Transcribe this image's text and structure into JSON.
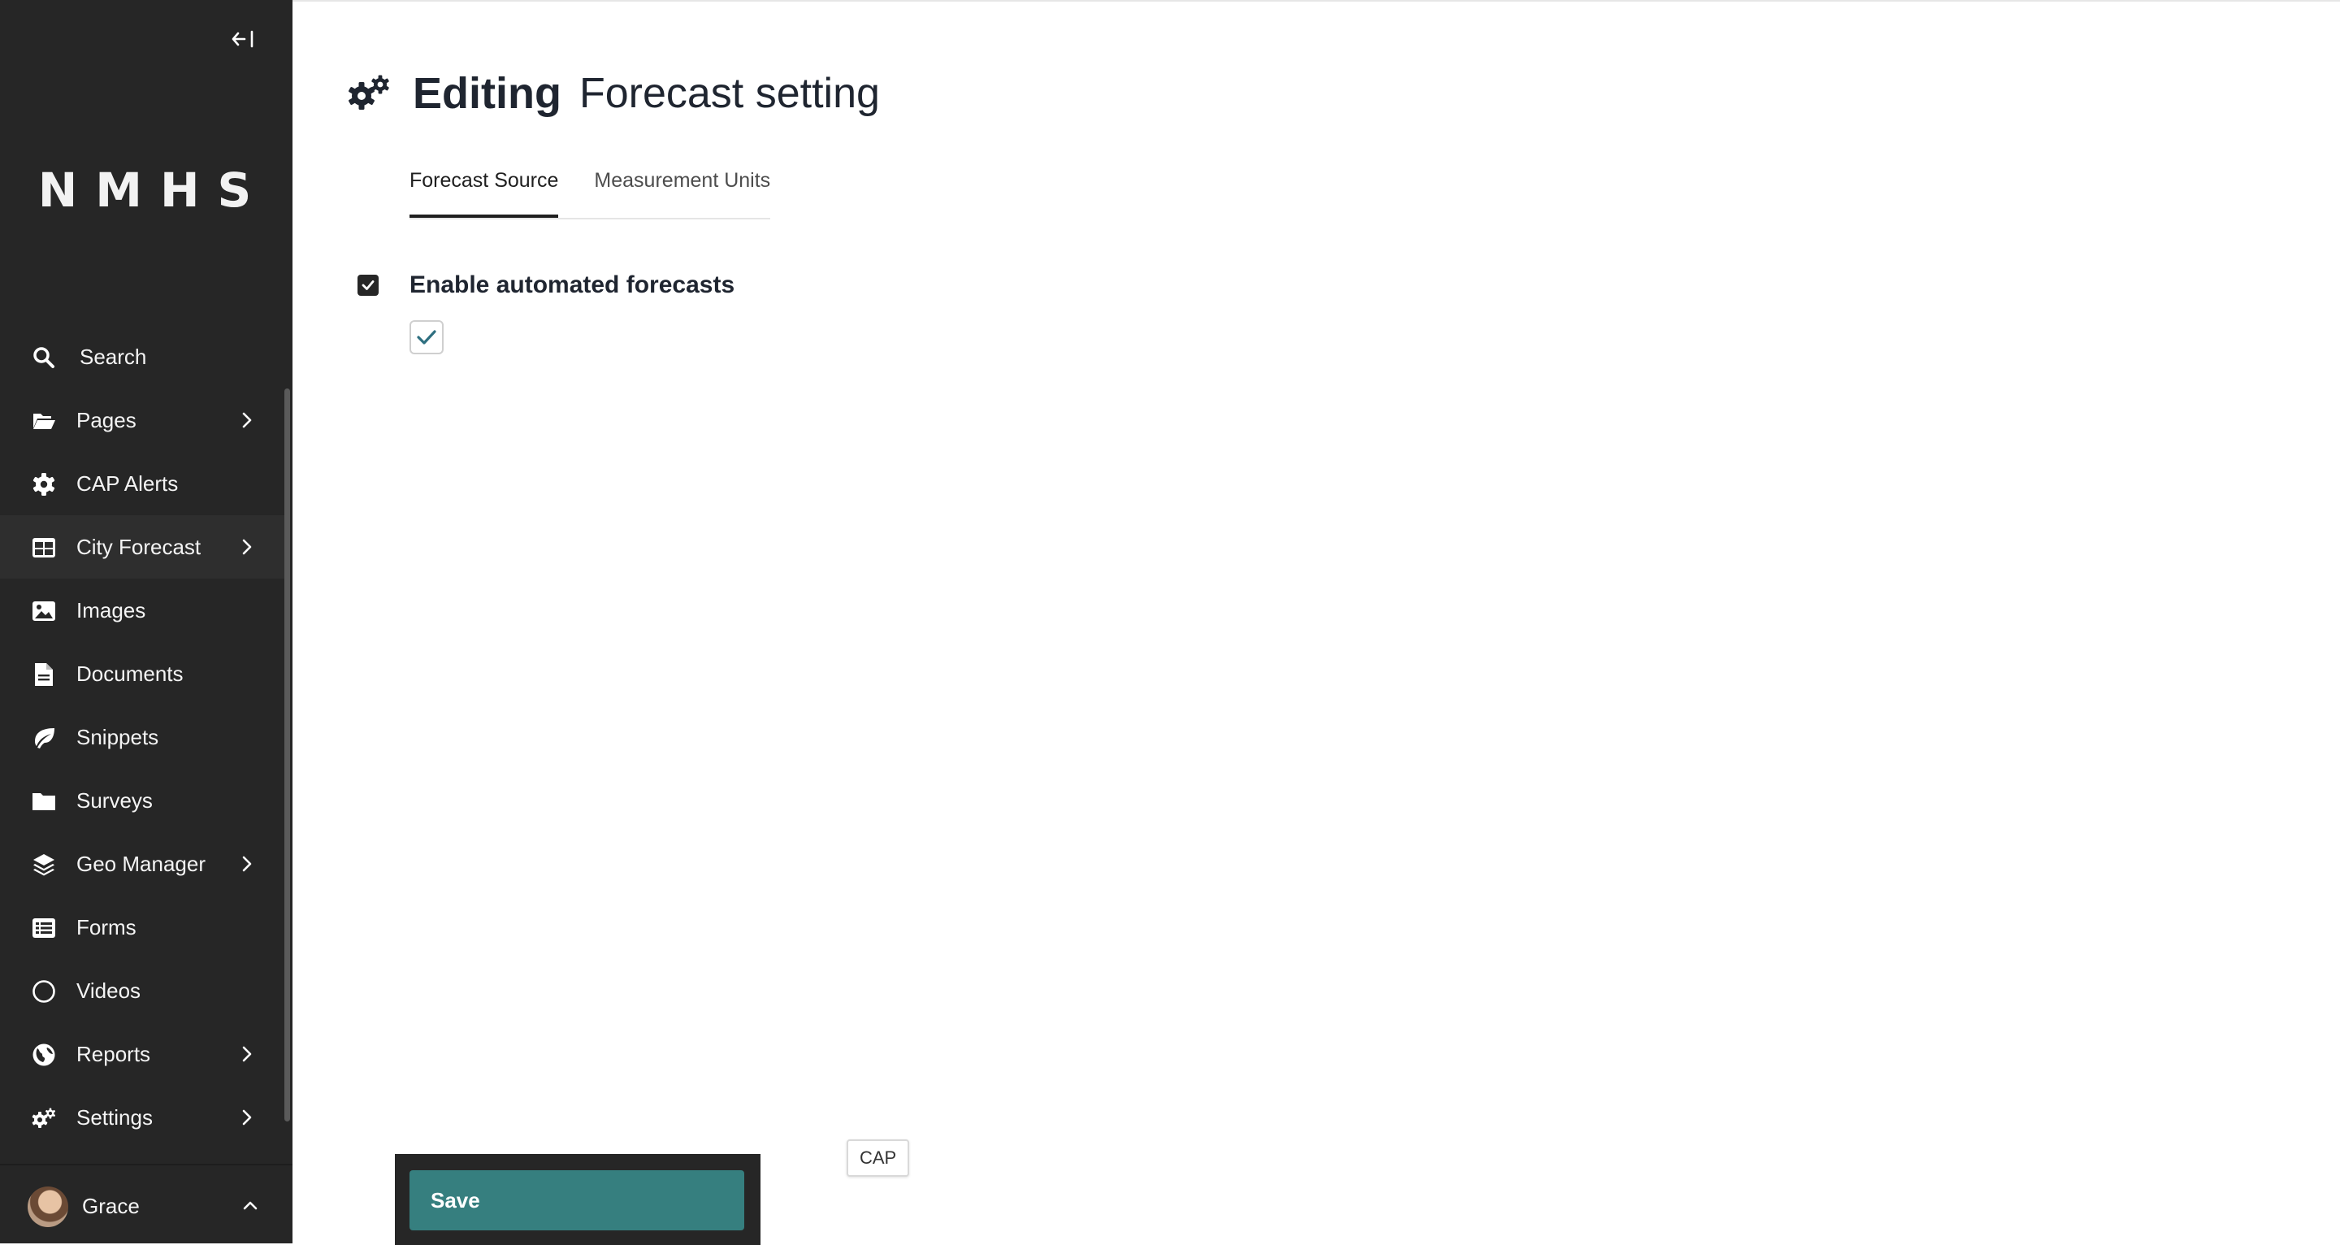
{
  "sidebar": {
    "collapse_icon": "collapse-left-icon",
    "logo": "NMHS",
    "items": [
      {
        "label": "Search",
        "icon": "search-icon",
        "has_children": false
      },
      {
        "label": "Pages",
        "icon": "folder-open-icon",
        "has_children": true
      },
      {
        "label": "CAP Alerts",
        "icon": "gear-icon",
        "has_children": false
      },
      {
        "label": "City Forecast",
        "icon": "table-icon",
        "has_children": true,
        "active": true
      },
      {
        "label": "Images",
        "icon": "image-icon",
        "has_children": false
      },
      {
        "label": "Documents",
        "icon": "document-icon",
        "has_children": false
      },
      {
        "label": "Snippets",
        "icon": "leaf-icon",
        "has_children": false
      },
      {
        "label": "Surveys",
        "icon": "folder-icon",
        "has_children": false
      },
      {
        "label": "Geo Manager",
        "icon": "layers-icon",
        "has_children": true
      },
      {
        "label": "Forms",
        "icon": "list-icon",
        "has_children": false
      },
      {
        "label": "Videos",
        "icon": "circle-icon",
        "has_children": false
      },
      {
        "label": "Reports",
        "icon": "globe-icon",
        "has_children": true
      },
      {
        "label": "Settings",
        "icon": "cogs-icon",
        "has_children": true
      }
    ],
    "user": {
      "name": "Grace"
    }
  },
  "header": {
    "title": "Editing",
    "subtitle": "Forecast setting",
    "icon": "cogs-icon"
  },
  "tabs": [
    {
      "label": "Forecast Source",
      "active": true
    },
    {
      "label": "Measurement Units",
      "active": false
    }
  ],
  "field": {
    "label": "Enable automated forecasts",
    "checked": true
  },
  "footer": {
    "save_label": "Save"
  },
  "tag": {
    "label": "CAP"
  },
  "colors": {
    "sidebar": "#262626",
    "save": "#367f7f",
    "check": "#2e6f80"
  }
}
